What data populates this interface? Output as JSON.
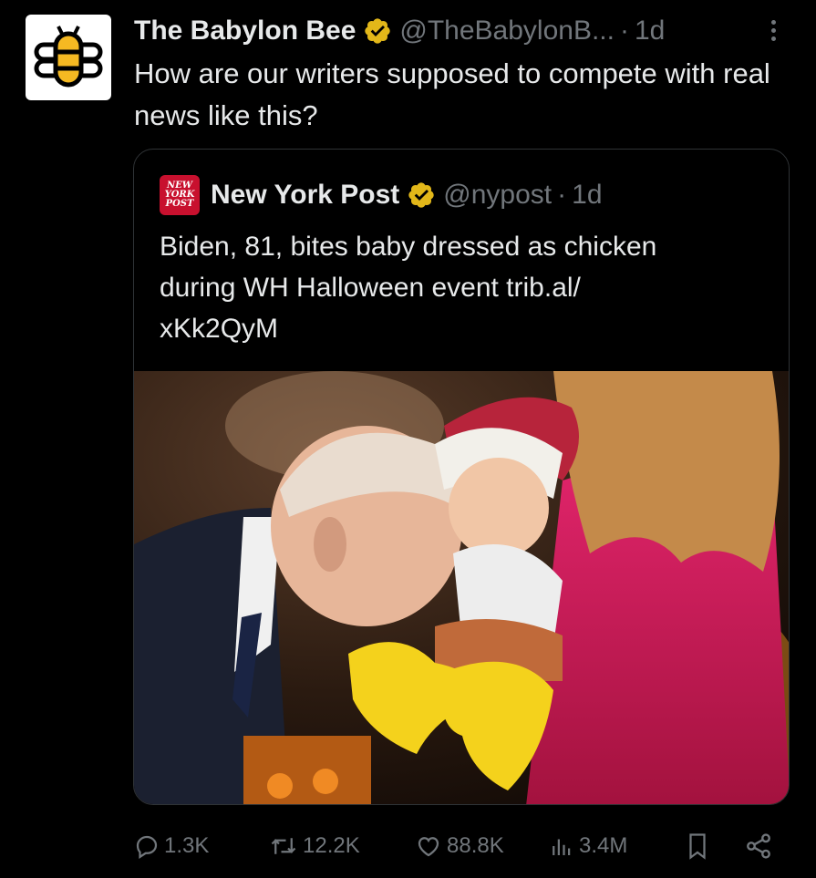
{
  "tweet": {
    "author_name": "The Babylon Bee",
    "author_handle": "@TheBabylonB...",
    "time": "1d",
    "separator": "·",
    "text": "How are our writers supposed to compete with real news like this?"
  },
  "quote": {
    "author_name": "New York Post",
    "author_handle": "@nypost",
    "time": "1d",
    "separator": "·",
    "logo_lines": [
      "NEW",
      "YORK",
      "POST"
    ],
    "text_line1": "Biden, 81, bites baby dressed as chicken",
    "text_line2": "during WH Halloween event trib.al/",
    "text_line3": "xKk2QyM"
  },
  "actions": {
    "replies": "1.3K",
    "reposts": "12.2K",
    "likes": "88.8K",
    "views": "3.4M"
  },
  "colors": {
    "background": "#000000",
    "text": "#e7e9ea",
    "muted": "#71767b",
    "verified_gold": "#e2b719",
    "nypost_red": "#c8102e",
    "bee_yellow": "#f5b922"
  },
  "icons": [
    "babylon-bee-logo-icon",
    "verified-badge-icon",
    "more-icon",
    "nypost-logo-icon",
    "reply-icon",
    "repost-icon",
    "like-icon",
    "views-icon",
    "bookmark-icon",
    "share-icon"
  ]
}
